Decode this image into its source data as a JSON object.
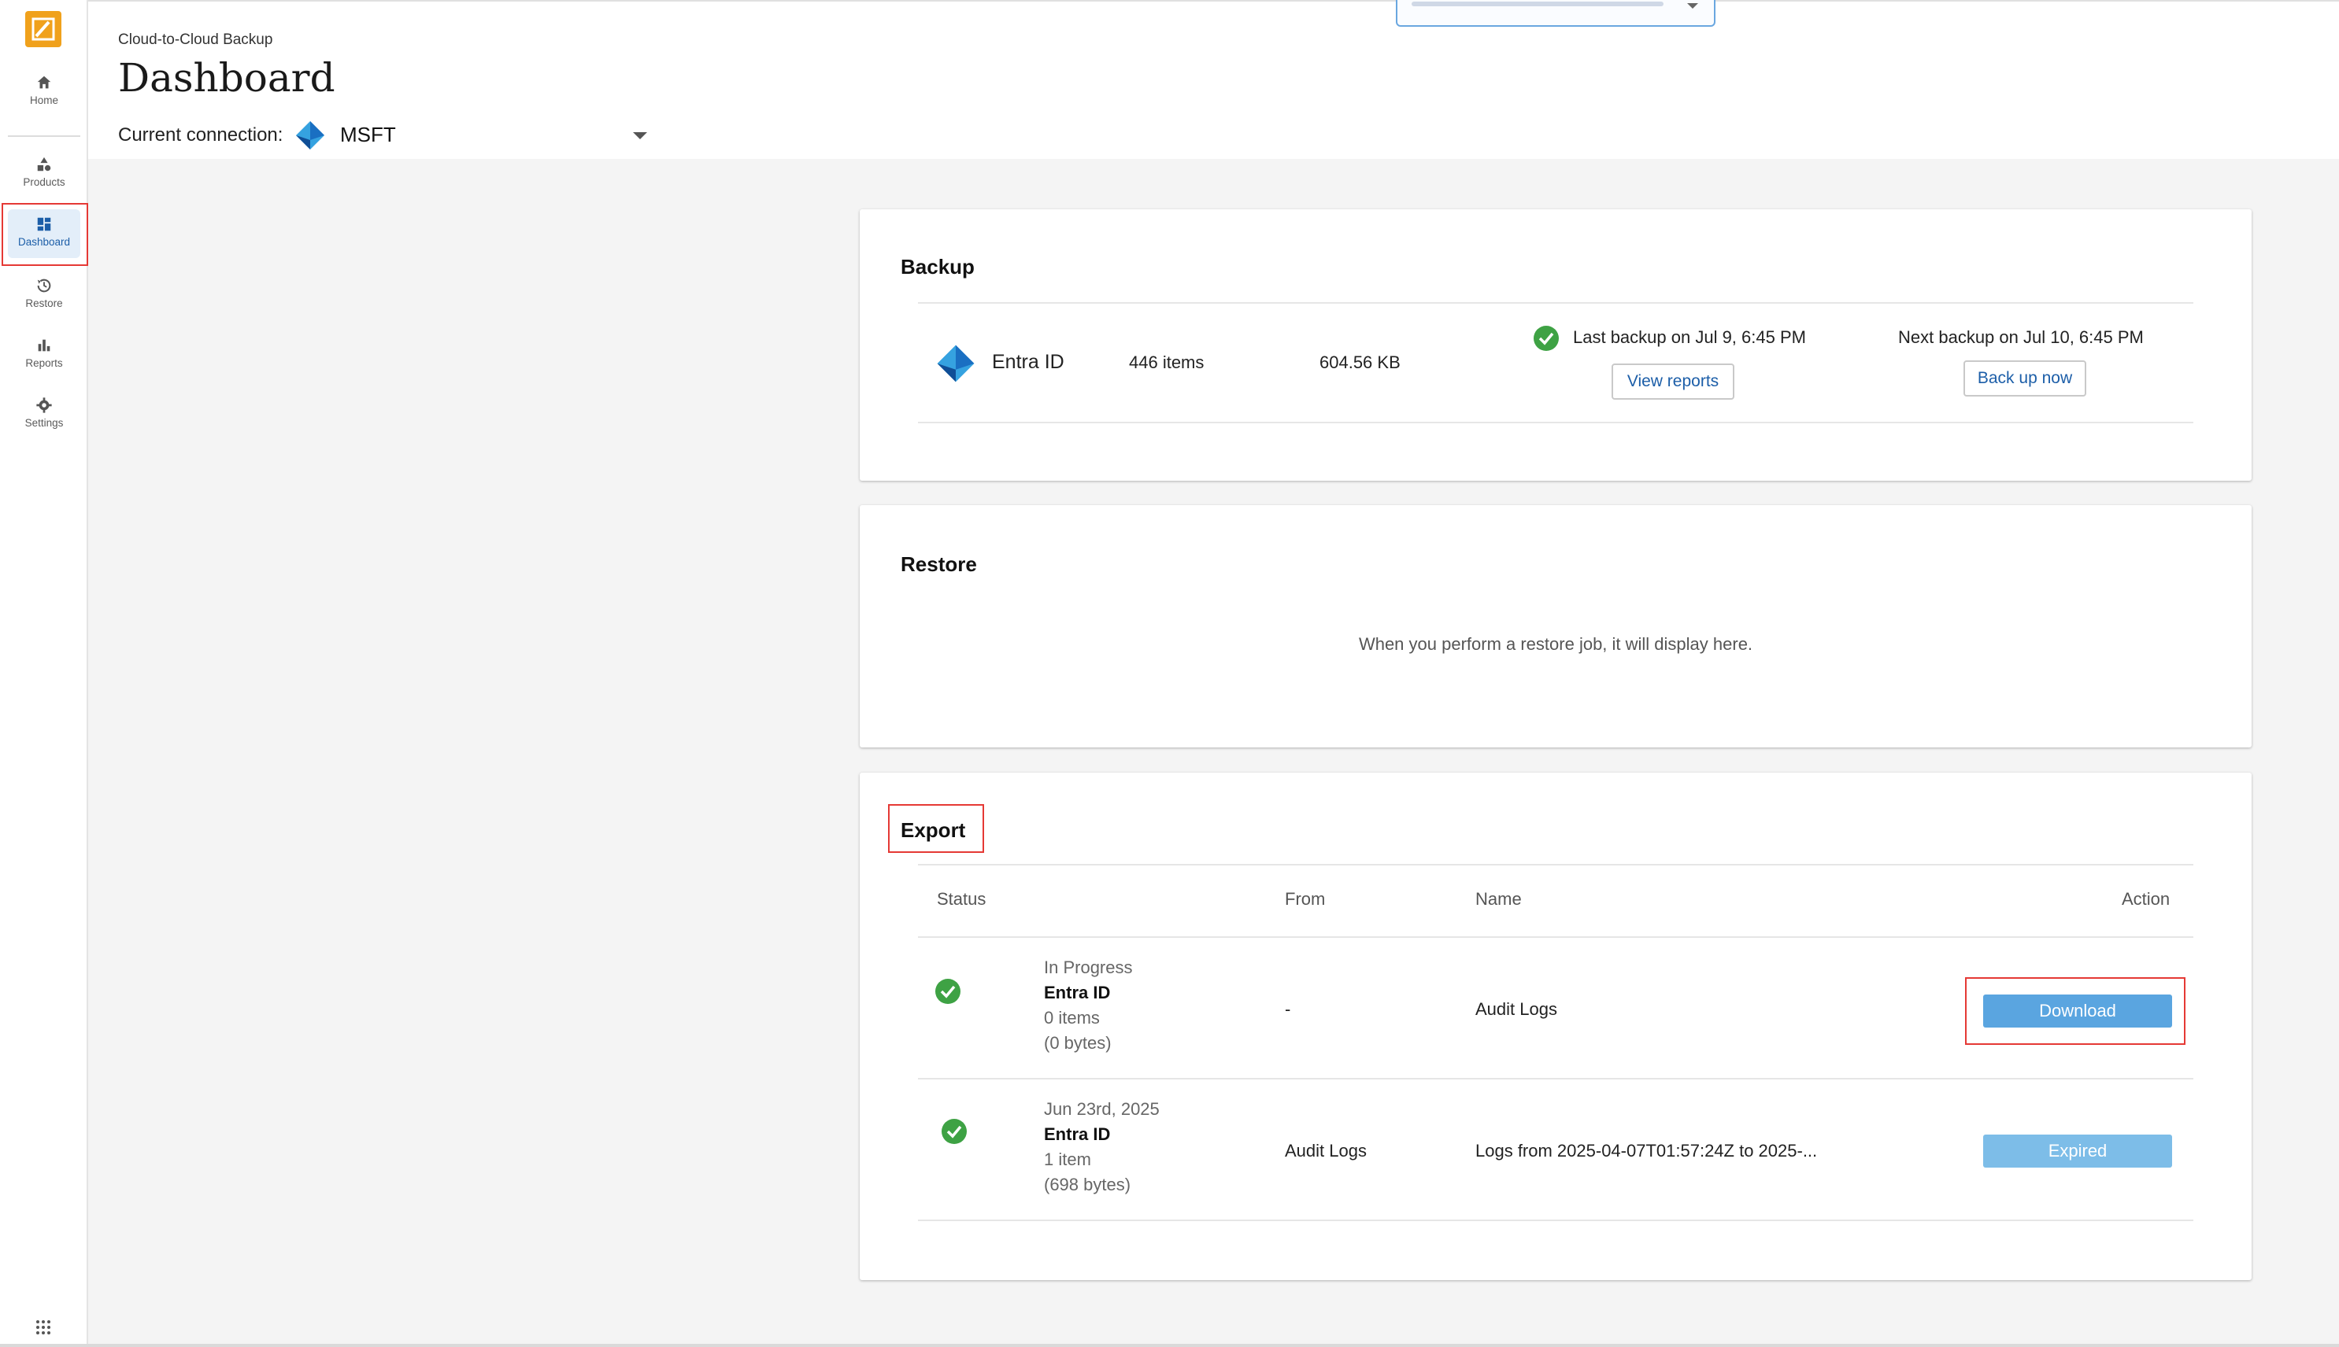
{
  "sidebar": {
    "items": [
      {
        "label": "Home",
        "icon": "home-icon"
      },
      {
        "label": "Products",
        "icon": "shapes-icon"
      },
      {
        "label": "Dashboard",
        "icon": "dashboard-icon"
      },
      {
        "label": "Restore",
        "icon": "history-icon"
      },
      {
        "label": "Reports",
        "icon": "bar-chart-icon"
      },
      {
        "label": "Settings",
        "icon": "gear-icon"
      }
    ],
    "active": "Dashboard"
  },
  "header": {
    "breadcrumb": "Cloud-to-Cloud Backup",
    "title": "Dashboard",
    "connection_label": "Current connection:",
    "connection_value": "MSFT"
  },
  "backup": {
    "title": "Backup",
    "service": "Entra ID",
    "items": "446 items",
    "size": "604.56 KB",
    "last_backup": "Last backup on Jul 9, 6:45 PM",
    "view_reports": "View reports",
    "next_backup": "Next backup on Jul 10, 6:45 PM",
    "back_up_now": "Back up now"
  },
  "restore": {
    "title": "Restore",
    "empty_message": "When you perform a restore job, it will display here."
  },
  "export": {
    "title": "Export",
    "columns": {
      "status": "Status",
      "from": "From",
      "name": "Name",
      "action": "Action"
    },
    "rows": [
      {
        "state": "In Progress",
        "service": "Entra ID",
        "items": "0 items",
        "bytes": "(0 bytes)",
        "from": "-",
        "name": "Audit Logs",
        "action": "Download"
      },
      {
        "state": "Jun 23rd, 2025",
        "service": "Entra ID",
        "items": "1 item",
        "bytes": "(698 bytes)",
        "from": "Audit Logs",
        "name": "Logs from 2025-04-07T01:57:24Z to 2025-...",
        "action": "Expired"
      }
    ]
  },
  "colors": {
    "accent": "#1c5ea8",
    "logo": "#f0a11c",
    "success": "#3ea244",
    "button": "#5aa5e0",
    "highlight": "#e53935"
  }
}
